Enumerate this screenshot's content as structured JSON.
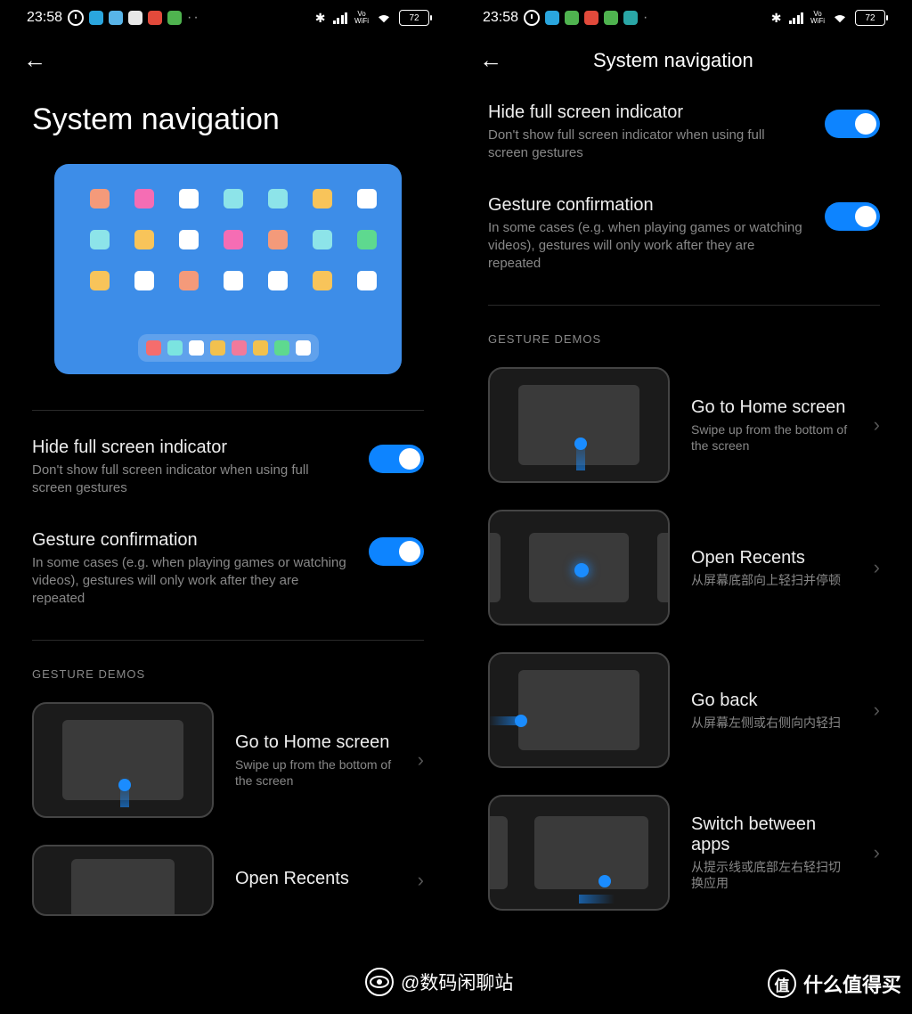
{
  "status": {
    "time": "23:58",
    "battery": "72",
    "vowifi": "Vo\nWiFi"
  },
  "header": {
    "title": "System navigation"
  },
  "pageTitle": "System navigation",
  "settings": {
    "hide": {
      "title": "Hide full screen indicator",
      "sub": "Don't show full screen indicator when using full screen gestures"
    },
    "gesture": {
      "title": "Gesture confirmation",
      "sub": "In some cases (e.g. when playing games or watching videos), gestures will only work after they are repeated"
    }
  },
  "sectionHeader": "GESTURE DEMOS",
  "demos": {
    "home": {
      "title": "Go to Home screen",
      "sub": "Swipe up from the bottom of the screen"
    },
    "recents": {
      "title": "Open Recents",
      "sub": "从屏幕底部向上轻扫并停顿"
    },
    "back": {
      "title": "Go back",
      "sub": "从屏幕左侧或右侧向内轻扫"
    },
    "switch": {
      "title": "Switch between apps",
      "sub": "从提示线或底部左右轻扫切换应用"
    }
  },
  "watermark1": "@数码闲聊站",
  "watermark2": "什么值得买",
  "watermark2badge": "值",
  "iconColors": [
    "#f49a7a",
    "#f56db4",
    "#ffffff",
    "#8de4e9",
    "#8de4e9",
    "#f8c45a",
    "#ffffff",
    "#8de4e9",
    "#f8c45a",
    "#ffffff",
    "#f56db4",
    "#f49a7a",
    "#8de4e9",
    "#5ed98f",
    "#f8c45a",
    "#ffffff",
    "#f49a7a",
    "#ffffff",
    "#ffffff",
    "#f8c45a",
    "#ffffff"
  ],
  "dockColors": [
    "#f56d6d",
    "#7be4e0",
    "#fff",
    "#f2c14e",
    "#f07a9b",
    "#f2c14e",
    "#5ed98f",
    "#fff"
  ],
  "sbApps": {
    "left": [
      "#2aa6de",
      "#58b4e8",
      "#e8e8e8",
      "#e24a3b",
      "#4fb34f"
    ],
    "right": [
      "#2aa6de",
      "#4fb34f",
      "#e24a3b",
      "#4fb34f",
      "#2aa6a6"
    ]
  }
}
